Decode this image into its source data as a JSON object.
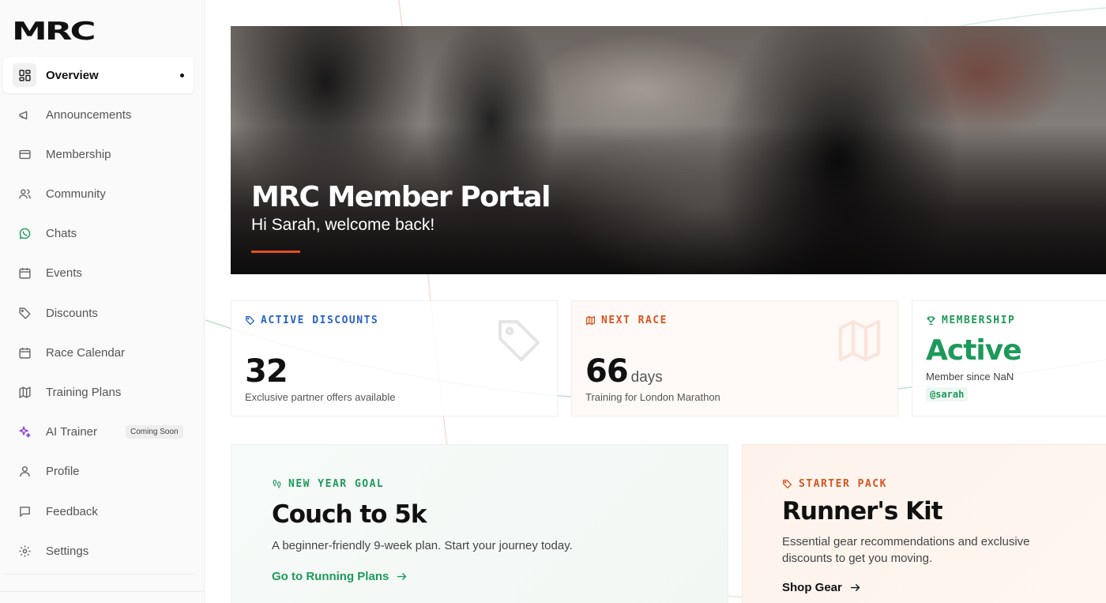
{
  "brand": {
    "logo_text": "MRC"
  },
  "sidebar": {
    "items": [
      {
        "label": "Overview",
        "icon": "grid-icon",
        "active": true
      },
      {
        "label": "Announcements",
        "icon": "megaphone-icon"
      },
      {
        "label": "Membership",
        "icon": "card-icon"
      },
      {
        "label": "Community",
        "icon": "users-icon"
      },
      {
        "label": "Chats",
        "icon": "whatsapp-icon"
      },
      {
        "label": "Events",
        "icon": "calendar-icon"
      },
      {
        "label": "Discounts",
        "icon": "tag-icon"
      },
      {
        "label": "Race Calendar",
        "icon": "calendar-days-icon"
      },
      {
        "label": "Training Plans",
        "icon": "map-icon"
      },
      {
        "label": "AI Trainer",
        "icon": "sparkles-icon",
        "badge": "Coming Soon"
      },
      {
        "label": "Profile",
        "icon": "user-icon"
      },
      {
        "label": "Feedback",
        "icon": "message-icon"
      },
      {
        "label": "Settings",
        "icon": "gear-icon"
      }
    ]
  },
  "hero": {
    "title": "MRC Member Portal",
    "subtitle": "Hi Sarah, welcome back!"
  },
  "stats": {
    "discounts": {
      "heading": "ACTIVE DISCOUNTS",
      "value": "32",
      "description": "Exclusive partner offers available"
    },
    "race": {
      "heading": "NEXT RACE",
      "value": "66",
      "unit": "days",
      "description": "Training for London Marathon"
    },
    "membership": {
      "heading": "MEMBERSHIP",
      "status": "Active",
      "since": "Member since NaN",
      "handle": "@sarah"
    }
  },
  "features": {
    "goal": {
      "heading": "NEW YEAR GOAL",
      "title": "Couch to 5k",
      "description": "A beginner-friendly 9-week plan. Start your journey today.",
      "link": "Go to Running Plans"
    },
    "kit": {
      "heading": "STARTER PACK",
      "title": "Runner's Kit",
      "description": "Essential gear recommendations and exclusive discounts to get you moving.",
      "link": "Shop Gear"
    }
  },
  "colors": {
    "accent_green": "#1d9a5b",
    "accent_orange": "#d9531e",
    "accent_blue": "#2563c9",
    "accent_purple": "#8b3fd9"
  }
}
